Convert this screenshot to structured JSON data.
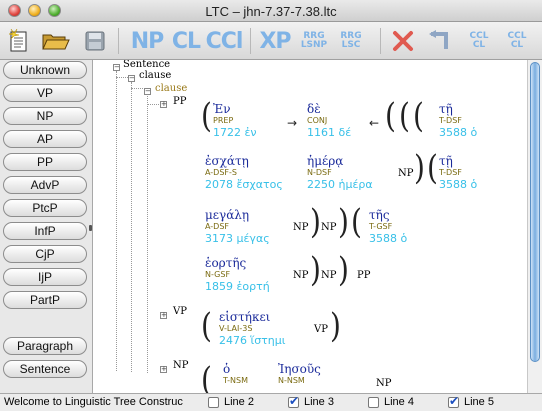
{
  "window": {
    "title": "LTC – jhn-7.37-7.38.ltc"
  },
  "toolbar": {
    "np": "NP",
    "cl": "CL",
    "ccl": "CCl",
    "xp": "XP",
    "rrg_lsnp": [
      "RRG",
      "LSNP"
    ],
    "rrg_lsc": [
      "RRG",
      "LSC"
    ],
    "ccl_a": [
      "CCL",
      "CL"
    ],
    "ccl_b": [
      "CCL",
      "CL"
    ]
  },
  "sidebar": {
    "buttons": [
      "Unknown",
      "VP",
      "NP",
      "AP",
      "PP",
      "AdvP",
      "PtcP",
      "InfP",
      "CjP",
      "IjP",
      "PartP"
    ],
    "bottom_buttons": [
      "Paragraph",
      "Sentence"
    ]
  },
  "tree": {
    "sentence": "Sentence",
    "clause1": "clause",
    "clause2": "clause",
    "pp": "PP",
    "vp": "VP",
    "np": "NP"
  },
  "words": {
    "w1": {
      "greek": "Ἐν",
      "parse": "PREP",
      "lemma": "1722 ἐν"
    },
    "w2": {
      "greek": "δὲ",
      "parse": "CONJ",
      "lemma": "1161 δέ"
    },
    "w3": {
      "greek": "τῇ",
      "parse": "T-DSF",
      "lemma": "3588 ὁ"
    },
    "w4": {
      "greek": "ἐσχάτῃ",
      "parse": "A-DSF-S",
      "lemma": "2078 ἔσχατος"
    },
    "w5": {
      "greek": "ἡμέρᾳ",
      "parse": "N-DSF",
      "lemma": "2250 ἡμέρα"
    },
    "w6": {
      "greek": "τῇ",
      "parse": "T-DSF",
      "lemma": "3588 ὁ"
    },
    "w7": {
      "greek": "μεγάλῃ",
      "parse": "A-DSF",
      "lemma": "3173 μέγας"
    },
    "w8": {
      "greek": "τῆς",
      "parse": "T-GSF",
      "lemma": "3588 ὁ"
    },
    "w9": {
      "greek": "ἑορτῆς",
      "parse": "N-GSF",
      "lemma": "1859 ἑορτή"
    },
    "w10": {
      "greek": "εἱστήκει",
      "parse": "V-LAI-3S",
      "lemma": "2476 ἵστημι"
    },
    "w11": {
      "greek": "ὁ",
      "parse": "T-NSM",
      "lemma": ""
    },
    "w12": {
      "greek": "Ἰησοῦς",
      "parse": "N-NSM",
      "lemma": ""
    }
  },
  "tags": {
    "np": "NP",
    "pp": "PP",
    "vp": "VP"
  },
  "status": {
    "message": "Welcome to Linguistic Tree Construc",
    "lines": [
      {
        "label": "Line 2",
        "checked": false
      },
      {
        "label": "Line 3",
        "checked": true
      },
      {
        "label": "Line 4",
        "checked": false
      },
      {
        "label": "Line 5",
        "checked": true
      }
    ]
  }
}
